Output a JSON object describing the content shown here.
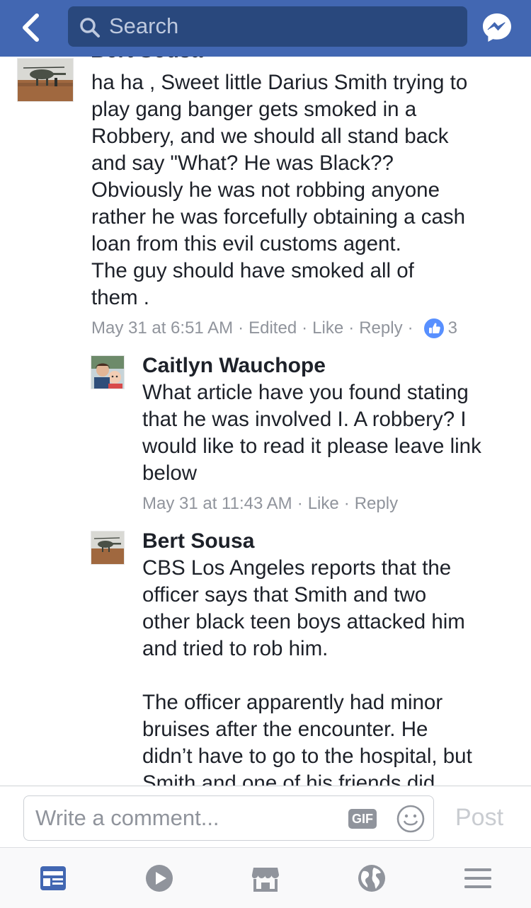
{
  "header": {
    "search_placeholder": "Search",
    "icons": [
      "back-chevron-icon",
      "search-icon",
      "messenger-icon"
    ],
    "colors": {
      "bar": "#4267b2",
      "search_field": "#29487d"
    }
  },
  "comments": [
    {
      "author": "Bert Sousa",
      "text": "ha ha , Sweet little Darius Smith trying to\nplay gang banger gets smoked in a\nRobbery, and we should all stand back\nand say \"What? He was Black??\nObviously he was not robbing anyone\nrather he was forcefully obtaining a cash\nloan from this evil customs agent.\nThe guy should have smoked all of\nthem .",
      "time": "May 31 at 6:51 AM",
      "edited": "Edited",
      "like": "Like",
      "reply": "Reply",
      "reactions": "3"
    },
    {
      "author": "Caitlyn Wauchope",
      "text": "What article have you found stating\nthat he was involved I. A robbery? I\nwould like to read it please leave link\nbelow",
      "time": "May 31 at 11:43 AM",
      "like": "Like",
      "reply": "Reply"
    },
    {
      "author": "Bert Sousa",
      "text": "CBS Los Angeles reports that the\nofficer says that Smith and two\nother black teen boys attacked him\nand tried to rob him.\n\nThe officer apparently had minor\nbruises after the encounter. He\ndidn’t have to go to the hospital, but\nSmith and one of his friends did."
    }
  ],
  "composer": {
    "placeholder": "Write a comment...",
    "gif_label": "GIF",
    "post_label": "Post"
  },
  "nav": {
    "items": [
      "news-feed-icon",
      "video-icon",
      "marketplace-icon",
      "notifications-globe-icon",
      "menu-icon"
    ],
    "active_color": "#4267b2",
    "inactive_color": "#90949c"
  }
}
